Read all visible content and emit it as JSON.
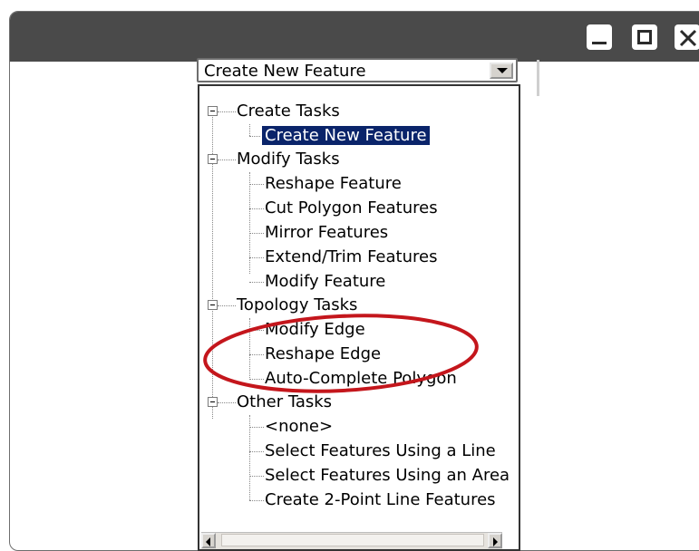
{
  "combo": {
    "value": "Create New Feature"
  },
  "tree": {
    "categories": [
      {
        "label": "Create Tasks",
        "items": [
          "Create New Feature"
        ]
      },
      {
        "label": "Modify Tasks",
        "items": [
          "Reshape Feature",
          "Cut Polygon Features",
          "Mirror Features",
          "Extend/Trim Features",
          "Modify Feature"
        ]
      },
      {
        "label": "Topology Tasks",
        "items": [
          "Modify Edge",
          "Reshape Edge",
          "Auto-Complete Polygon"
        ]
      },
      {
        "label": "Other Tasks",
        "items": [
          "<none>",
          "Select Features Using a Line",
          "Select Features Using an Area",
          "Create 2-Point Line Features"
        ]
      }
    ],
    "selected": "Create New Feature"
  },
  "colors": {
    "titlebar": "#4a4a4a",
    "selection": "#0a246a",
    "annotation": "#c4161c"
  }
}
